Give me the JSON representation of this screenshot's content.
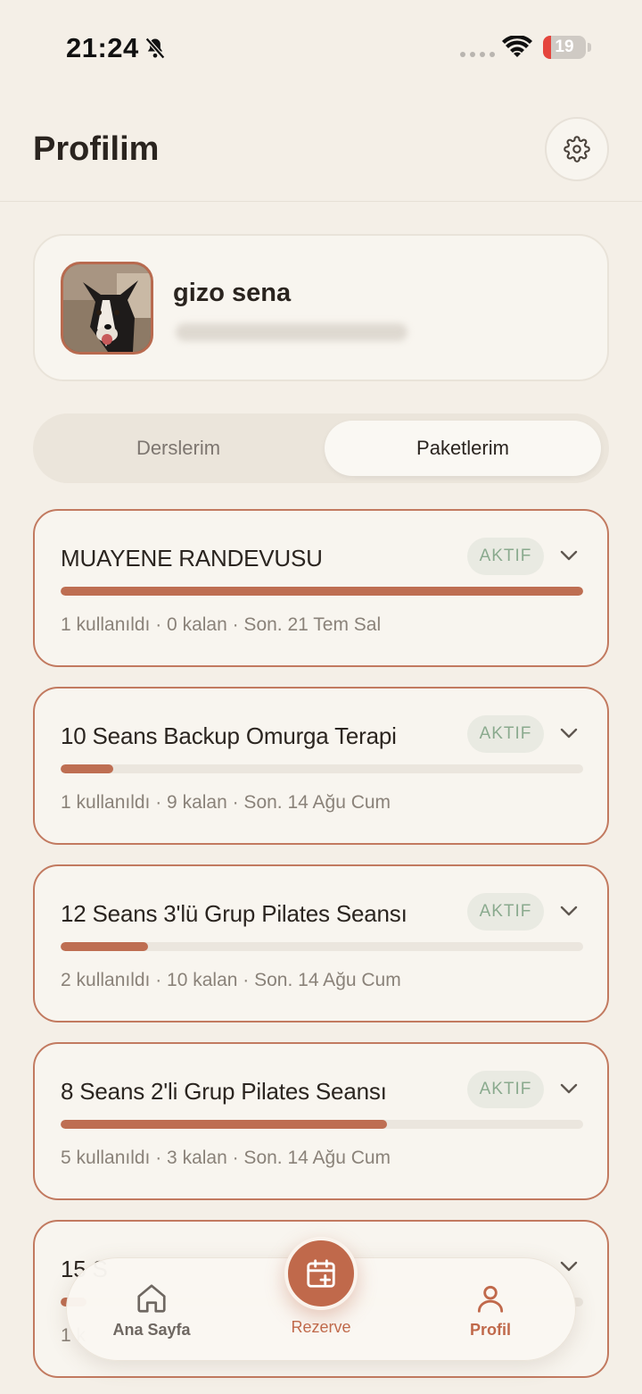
{
  "status_bar": {
    "time": "21:24",
    "battery_level": "19",
    "battery_fraction": 0.19
  },
  "header": {
    "title": "Profilim",
    "settings_icon": "gear-icon"
  },
  "profile": {
    "name": "gizo sena",
    "email_hidden": true
  },
  "tabs": {
    "items": [
      "Derslerim",
      "Paketlerim"
    ],
    "active": "Paketlerim"
  },
  "packages": [
    {
      "title": "MUAYENE RANDEVUSU",
      "status": "AKTIF",
      "meta": "1 kullanıldı · 0 kalan · Son. 21 Tem Sal",
      "progress": 1.0
    },
    {
      "title": "10 Seans Backup Omurga Terapi",
      "status": "AKTIF",
      "meta": "1 kullanıldı · 9 kalan · Son. 14 Ağu Cum",
      "progress": 0.1
    },
    {
      "title": "12 Seans 3'lü Grup Pilates Seansı",
      "status": "AKTIF",
      "meta": "2 kullanıldı · 10 kalan · Son. 14 Ağu Cum",
      "progress": 0.1667
    },
    {
      "title": "8 Seans 2'li Grup Pilates Seansı",
      "status": "AKTIF",
      "meta": "5 kullanıldı · 3 kalan · Son. 14 Ağu Cum",
      "progress": 0.625
    },
    {
      "title": "15 S",
      "status": "",
      "meta": "1 k",
      "progress": 0.05
    }
  ],
  "bottom_nav": {
    "home_label": "Ana Sayfa",
    "reserve_label": "Rezerve",
    "profile_label": "Profil"
  },
  "colors": {
    "accent": "#c0694b",
    "background": "#f4efe7",
    "badge_text": "#8aaa8e"
  }
}
